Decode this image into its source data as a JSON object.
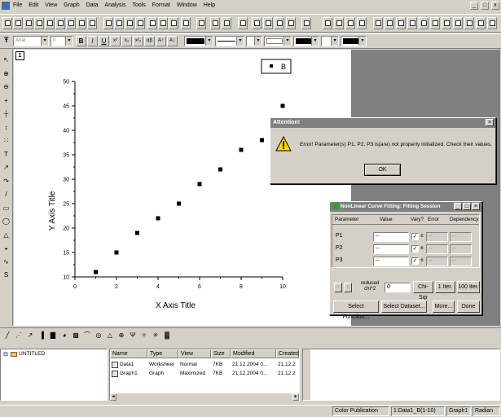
{
  "menu": [
    "File",
    "Edit",
    "View",
    "Graph",
    "Data",
    "Analysis",
    "Tools",
    "Format",
    "Window",
    "Help"
  ],
  "window_controls": [
    "_",
    "□",
    "x"
  ],
  "format_toolbar": {
    "font": "Arial",
    "font_size": "0",
    "bold": "B",
    "italic": "I",
    "underline": "U",
    "superscript": "x²",
    "subscript": "x₂",
    "super_sub": "x²₂",
    "greek": "αβ",
    "grow": "A↑",
    "shrink": "A↓"
  },
  "layer_label": "1",
  "left_tools": [
    "↖",
    "⊕",
    "⊖",
    "+",
    "┼",
    "↕",
    "∷",
    "T",
    "↗",
    "↷",
    "/",
    "▭",
    "◯",
    "△",
    "◒",
    "∿",
    "S"
  ],
  "chart_data": {
    "type": "scatter",
    "x": [
      1,
      2,
      3,
      4,
      5,
      6,
      7,
      8,
      9,
      10
    ],
    "y": [
      11,
      15,
      19,
      22,
      25,
      29,
      32,
      36,
      38,
      45
    ],
    "xlabel": "X Axis Title",
    "ylabel": "Y Axis Title",
    "xlim": [
      0,
      10
    ],
    "ylim": [
      10,
      50
    ],
    "xticks": [
      "0",
      "2",
      "4",
      "6",
      "8",
      "10"
    ],
    "yticks": [
      "10",
      "15",
      "20",
      "25",
      "30",
      "35",
      "40",
      "45",
      "50"
    ],
    "legend": {
      "label": "B",
      "placement": "top-right"
    },
    "marker_color": "#000000"
  },
  "attention_dialog": {
    "title": "Attention!",
    "message": "Error! Parameter(s) P1, P2, P3 is(are) not properly initialized. Check their values.",
    "ok_label": "OK"
  },
  "nlfit_dialog": {
    "title": "NonLinear Curve Fitting: Fitting Session",
    "headers": {
      "parameter": "Parameter",
      "value": "Value",
      "vary": "Vary?",
      "error": "Error",
      "dependency": "Dependency"
    },
    "params": [
      {
        "name": "P1",
        "value": "--",
        "vary": "✓",
        "pm": "±",
        "error": "--",
        "dependency": "--"
      },
      {
        "name": "P2",
        "value": "--",
        "vary": "✓",
        "pm": "±",
        "error": "--",
        "dependency": "--"
      },
      {
        "name": "P3",
        "value": "--",
        "vary": "✓",
        "pm": "±",
        "error": "--",
        "dependency": "--"
      }
    ],
    "reduced_label_1": "reduced",
    "reduced_label_2": "chi^2",
    "reduced_value": "0",
    "chi_sqr": "Chi-Sqr",
    "iter_1": "1 Iter.",
    "iter_100": "100 Iter.",
    "select_function": "Select Function...",
    "select_dataset": "Select Dataset...",
    "more": "More...",
    "done": "Done"
  },
  "explorer": {
    "root_label": "UNTITLED",
    "columns": [
      "Name",
      "Type",
      "View",
      "Size",
      "Modified",
      "Created"
    ],
    "rows": [
      {
        "name": "Data1",
        "type": "Worksheet",
        "view": "Normal",
        "size": "7KB",
        "modified": "21.12.2004 0...",
        "created": "21.12.2"
      },
      {
        "name": "Graph1",
        "type": "Graph",
        "view": "Maximized",
        "size": "7KB",
        "modified": "21.12.2004 0...",
        "created": "21.12.2"
      }
    ]
  },
  "status": {
    "publication": "Color Publication",
    "dataset": "1:Data1_B(1-10)",
    "window": "Graph1",
    "angle": "Radian"
  },
  "colors": {
    "face": "#d4d0c8",
    "title_inactive": "#808080",
    "warning": "#ffd700"
  }
}
